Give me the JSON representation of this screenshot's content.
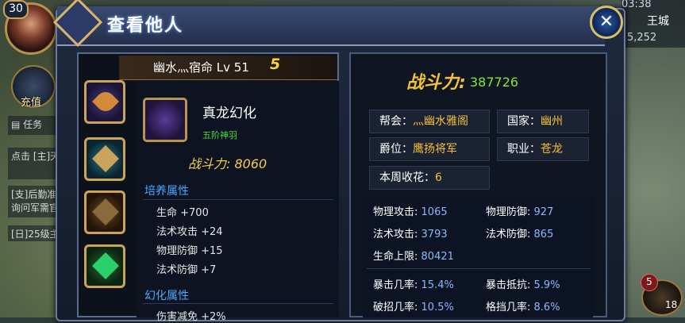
{
  "hud": {
    "level": "30",
    "recharge_label": "充值",
    "task_label": "任务",
    "chat": [
      "点击 [主]天",
      "[支]后勤准 询问军需官",
      "[日]25级主"
    ],
    "time": "03:38",
    "city": "王城",
    "coins": "5,252"
  },
  "window": {
    "title": "查看他人",
    "close_label": "✕"
  },
  "player": {
    "name": "幽水灬宿命 Lv 51",
    "tier": "5"
  },
  "item": {
    "name": "真龙幻化",
    "sub": "五阶神羽",
    "power": "战斗力: 8060",
    "sections": [
      {
        "title": "培养属性",
        "attrs": [
          "生命 +700",
          "法术攻击 +24",
          "物理防御 +15",
          "法术防御 +7"
        ]
      },
      {
        "title": "幻化属性",
        "attrs": [
          "伤害减免 +2%"
        ]
      }
    ]
  },
  "power": {
    "label": "战斗力:",
    "value": "387726"
  },
  "info": {
    "guild_label": "帮会：",
    "guild_value": "灬幽水雅阁",
    "country_label": "国家：",
    "country_value": "幽州",
    "rank_label": "爵位：",
    "rank_value": "鹰扬将军",
    "class_label": "职业：",
    "class_value": "苍龙",
    "flowers_label": "本周收花：",
    "flowers_value": "6"
  },
  "stats": [
    {
      "label": "物理攻击:",
      "value": "1065"
    },
    {
      "label": "物理防御:",
      "value": "927"
    },
    {
      "label": "法术攻击:",
      "value": "3793"
    },
    {
      "label": "法术防御:",
      "value": "865"
    },
    {
      "label": "生命上限:",
      "value": "80421"
    },
    {
      "label": "暴击几率:",
      "value": "15.4%"
    },
    {
      "label": "暴击抵抗:",
      "value": "5.9%"
    },
    {
      "label": "破招几率:",
      "value": "10.5%"
    },
    {
      "label": "格挡几率:",
      "value": "8.6%"
    }
  ],
  "bag": {
    "badge": "5",
    "count": "18"
  }
}
